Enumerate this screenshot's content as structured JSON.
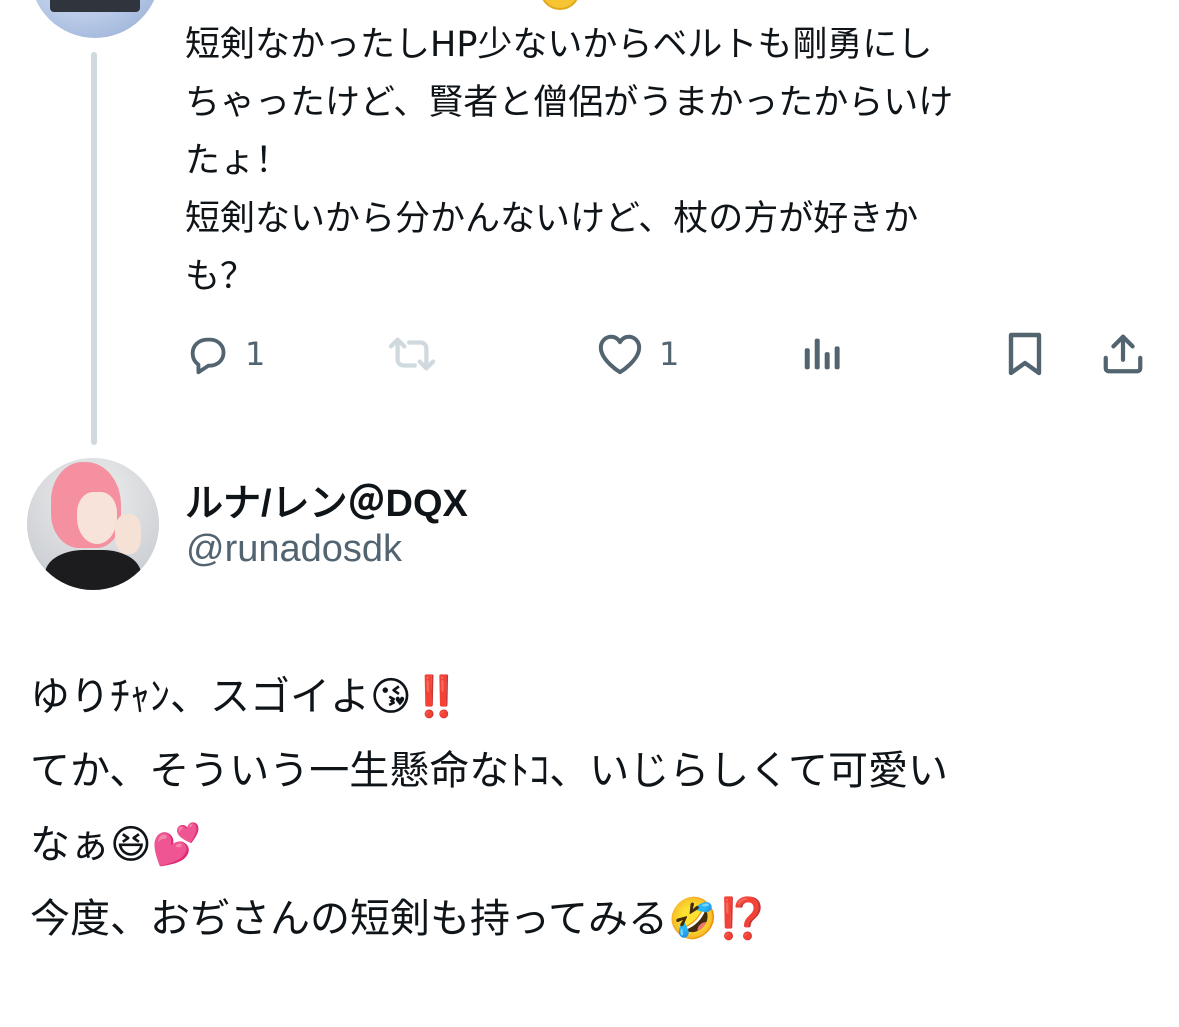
{
  "reply": {
    "lines": [
      "短剣なかったしHP少ないからベルトも剛勇にし",
      "ちゃったけど、賢者と僧侶がうまかったからいけ",
      "たょ！",
      "短剣ないから分かんないけど、杖の方が好きか",
      "も？"
    ],
    "actions": {
      "reply_count": "1",
      "retweet_count": "",
      "like_count": "1"
    },
    "icons": {
      "reply": "reply-icon",
      "retweet": "retweet-icon",
      "like": "heart-icon",
      "views": "views-icon",
      "bookmark": "bookmark-icon",
      "share": "share-icon"
    }
  },
  "tweet": {
    "display_name": "ルナ/レン＠DQX",
    "handle": "@runadosdk",
    "lines": [
      "ゆりﾁｬﾝ、スゴイよ😘‼️",
      "てか、そういう一生懸命なﾄｺ、いじらしくて可愛い",
      "なぁ😆💕",
      "今度、おぢさんの短剣も持ってみる🤣⁉️"
    ]
  },
  "colors": {
    "text": "#0f1419",
    "secondary": "#536471",
    "thread_line": "#cfd9de",
    "background": "#ffffff"
  }
}
